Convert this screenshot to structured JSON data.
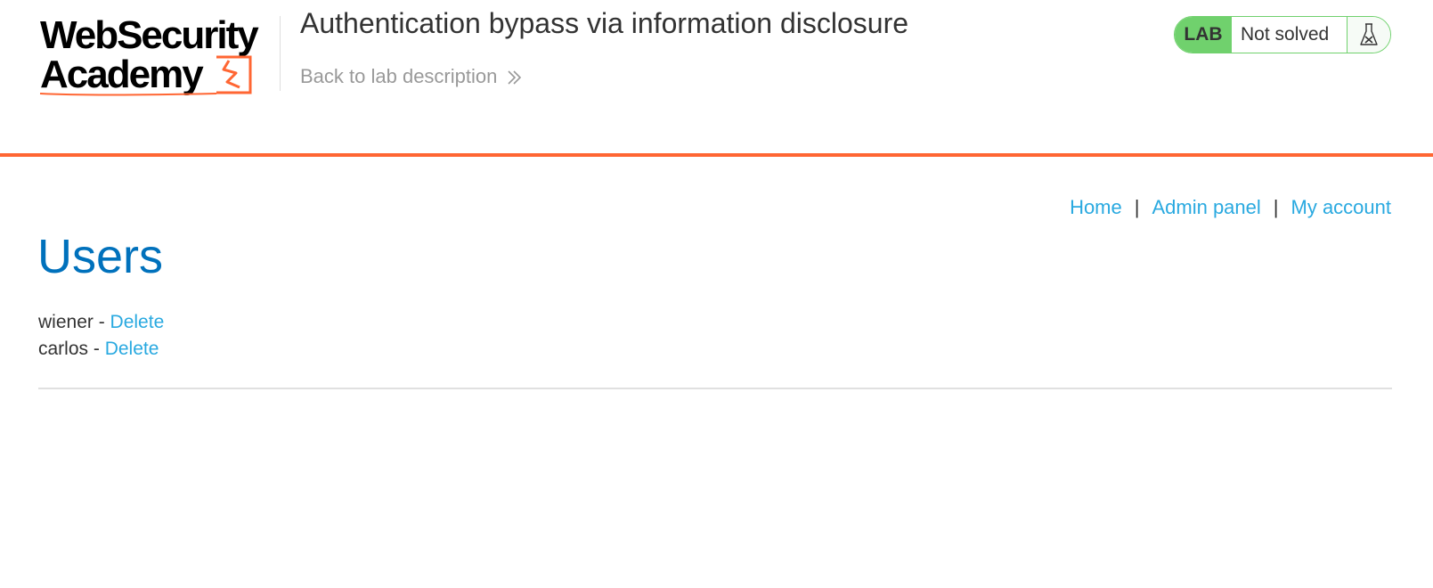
{
  "brand": {
    "logo_line1": "WebSecurity",
    "logo_line2": "Academy",
    "accent_color": "#ff6633",
    "link_color": "#29a9e0",
    "heading_color": "#0071bc",
    "status_green": "#70d16d"
  },
  "header": {
    "lab_title": "Authentication bypass via information disclosure",
    "back_link_label": "Back to lab description",
    "back_link_icon": "double-chevron-right-icon"
  },
  "lab_status": {
    "badge": "LAB",
    "state": "Not solved",
    "icon": "flask-icon"
  },
  "nav": {
    "items": [
      {
        "label": "Home"
      },
      {
        "label": "Admin panel"
      },
      {
        "label": "My account"
      }
    ],
    "separator": "|"
  },
  "main": {
    "heading": "Users",
    "users": [
      {
        "name": "wiener",
        "dash": " - ",
        "action": "Delete"
      },
      {
        "name": "carlos",
        "dash": " - ",
        "action": "Delete"
      }
    ]
  }
}
